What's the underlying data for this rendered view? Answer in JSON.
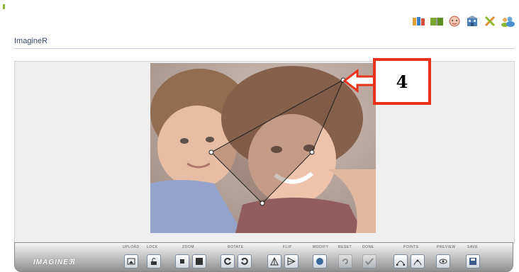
{
  "app": {
    "title": "ImagineR"
  },
  "top_icons": [
    {
      "icon": "books-icon",
      "color": "#e0a030"
    },
    {
      "icon": "book-icon",
      "color": "#7aa830"
    },
    {
      "icon": "face-icon",
      "color": "#e58a8a"
    },
    {
      "icon": "building-icon",
      "color": "#4a7fb8"
    },
    {
      "icon": "tools-icon",
      "color": "#e0902a"
    },
    {
      "icon": "people-icon",
      "color": "#6aa8d8"
    }
  ],
  "toolbar": {
    "brand": "IMAGINEℜ",
    "groups": {
      "upload": "UPLOAD",
      "lock": "LOCK",
      "zoom": "ZOOM",
      "rotate": "ROTATE",
      "flip": "FLIP",
      "modify": "MODIFY",
      "reset": "RESET",
      "done": "DONE",
      "points": "POINTS",
      "preview": "PREVIEW",
      "save": "SAVE"
    }
  },
  "callout": {
    "label": "4",
    "color": "#e8321c"
  }
}
